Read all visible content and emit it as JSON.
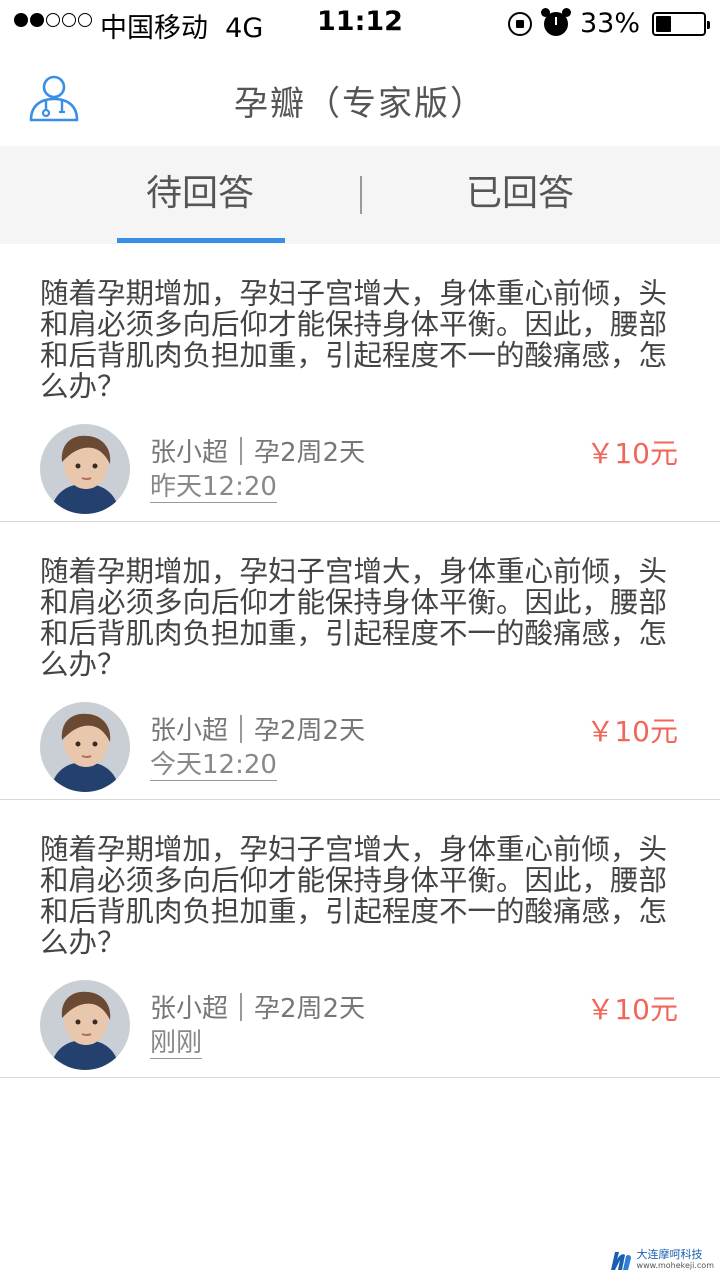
{
  "status_bar": {
    "carrier": "中国移动",
    "network": "4G",
    "time": "11:12",
    "battery_percent": "33%",
    "battery_level": 0.33
  },
  "nav": {
    "title": "孕瓣（专家版）",
    "icon": "doctor-icon",
    "accent_color": "#3a8ee6"
  },
  "tabs": [
    {
      "label": "待回答",
      "active": true
    },
    {
      "label": "已回答",
      "active": false
    }
  ],
  "questions": [
    {
      "text": "随着孕期增加，孕妇子宫增大，身体重心前倾，头和肩必须多向后仰才能保持身体平衡。因此，腰部和后背肌肉负担加重，引起程度不一的酸痛感，怎么办？",
      "user_name": "张小超",
      "pregnancy": "孕2周2天",
      "time": "昨天12:20",
      "price": "￥10元"
    },
    {
      "text": "随着孕期增加，孕妇子宫增大，身体重心前倾，头和肩必须多向后仰才能保持身体平衡。因此，腰部和后背肌肉负担加重，引起程度不一的酸痛感，怎么办？",
      "user_name": "张小超",
      "pregnancy": "孕2周2天",
      "time": "今天12:20",
      "price": "￥10元"
    },
    {
      "text": "随着孕期增加，孕妇子宫增大，身体重心前倾，头和肩必须多向后仰才能保持身体平衡。因此，腰部和后背肌肉负担加重，引起程度不一的酸痛感，怎么办？",
      "user_name": "张小超",
      "pregnancy": "孕2周2天",
      "time": "刚刚",
      "price": "￥10元"
    }
  ],
  "price_color": "#f2665a",
  "watermark": {
    "name": "大连摩呵科技",
    "url": "www.mohekeji.com"
  }
}
